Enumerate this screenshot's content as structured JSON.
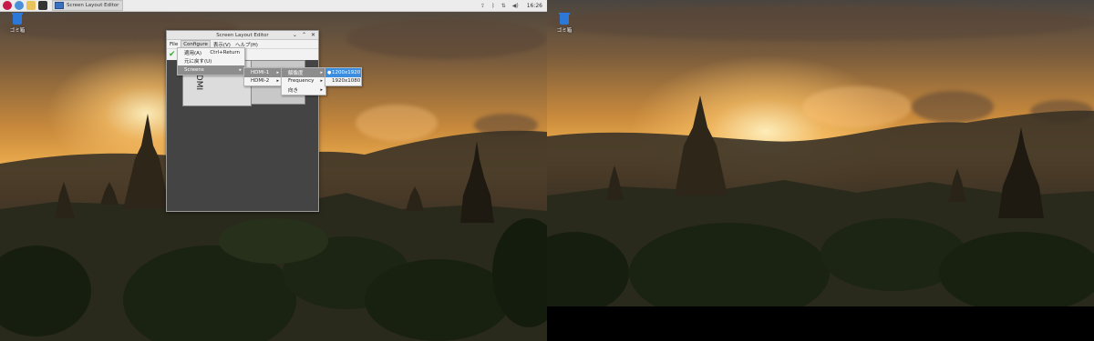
{
  "taskbar": {
    "task_label": "Screen Layout Editor",
    "clock": "16:26",
    "icons": [
      "raspberry-menu-icon",
      "browser-icon",
      "file-manager-icon",
      "terminal-icon"
    ]
  },
  "desktop": {
    "trash_label": "ゴミ箱"
  },
  "window": {
    "title": "Screen Layout Editor",
    "controls": {
      "minimize": "⌄",
      "maximize": "⌃",
      "close": "✕"
    },
    "menubar": [
      "File",
      "Configure",
      "表示(V)",
      "ヘルプ(H)"
    ],
    "monitor_label": "HDMI"
  },
  "configure_menu": {
    "items": [
      {
        "label": "適用(A)",
        "shortcut": "Ctrl+Return"
      },
      {
        "label": "元に戻す(U)",
        "shortcut": ""
      },
      {
        "label": "Screens",
        "shortcut": ""
      }
    ]
  },
  "screens_menu": {
    "items": [
      "HDMI-1",
      "HDMI-2"
    ]
  },
  "hdmi1_menu": {
    "items": [
      "解像度",
      "Frequency",
      "向き"
    ]
  },
  "resolution_menu": {
    "items": [
      "1200x1920",
      "1920x1080"
    ],
    "selected": "1200x1920"
  },
  "colors": {
    "accent": "#3b8de0",
    "highlight": "#8d8d8d",
    "trash": "#2b78d8"
  }
}
